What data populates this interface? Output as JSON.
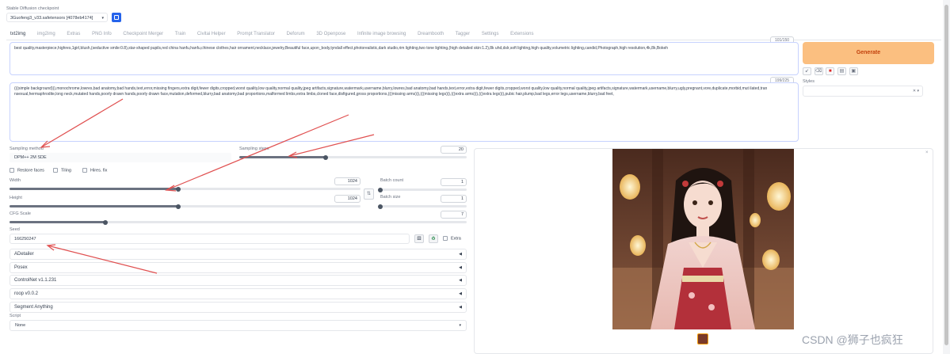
{
  "checkpoint": {
    "label": "Stable Diffusion checkpoint",
    "value": "3Guofeng3_v33.safetensors [4078eb4174]"
  },
  "tabs": [
    "txt2img",
    "img2img",
    "Extras",
    "PNG Info",
    "Checkpoint Merger",
    "Train",
    "Civitai Helper",
    "Prompt Translator",
    "Deforum",
    "3D Openpose",
    "Infinite image browsing",
    "Dreambooth",
    "Tagger",
    "Settings",
    "Extensions"
  ],
  "prompt": {
    "counter": "101/150",
    "text": "best quality,masterpiece,highres,1girl,blush,(seductive smile:0.8),star-shaped pupils,red china hanfu,hanfu,chinese clothes,hair ornament,necklace,jewelry,Beautiful face,upon_body,tyndall effect,photorealistic,dark studio,rim lighting,two tone lighting,(high detailed skin:1.2),8k uhd,dslr,soft lighting,high quality,volumetric lighting,candid,Photograph,high resolution,4k,8k,Bokeh"
  },
  "negative_prompt": {
    "counter": "199/225",
    "text": "(((simple background))),monochrome,lowres,bad anatomy,bad hands,text,error,missing fingers,extra digit,fewer digits,cropped,worst quality,low quality,normal quality,jpeg artifacts,signature,watermark,username,blurry,lowres,bad anatomy,bad hands,text,error,extra digit,fewer digits,cropped,worst quality,low quality,normal quality,jpeg artifacts,signature,watermark,username,blurry,ugly,pregnant,vore,duplicate,morbid,mut ilated,tran nsexual,hermaphrodite,long neck,mutated hands,poorly drawn hands,poorly drawn face,mutation,deformed,blurry,bad anatomy,bad proportions,malformed limbs,extra limbs,cloned face,disfigured,gross proportions,(((missing arms))),(((missing legs))),(((extra arms))),(((extra legs))),pubic hair,plump,bad legs,error legs,username,blurry,bad feet,"
  },
  "generate_label": "Generate",
  "styles_label": "Styles",
  "sampling": {
    "method_label": "Sampling method",
    "method_value": "DPM++ 2M SDE",
    "steps_label": "Sampling steps",
    "steps_value": "20",
    "steps_fraction": 0.38
  },
  "options": {
    "restore_faces": "Restore faces",
    "tiling": "Tiling",
    "hires_fix": "Hires. fix"
  },
  "width": {
    "label": "Width",
    "value": "1024",
    "fraction": 0.48
  },
  "height": {
    "label": "Height",
    "value": "1024",
    "fraction": 0.48
  },
  "batch_count": {
    "label": "Batch count",
    "value": "1",
    "fraction": 0.0
  },
  "batch_size": {
    "label": "Batch size",
    "value": "1",
    "fraction": 0.0
  },
  "swap_icon": "swap-icon",
  "cfg": {
    "label": "CFG Scale",
    "value": "7",
    "fraction": 0.21
  },
  "seed": {
    "label": "Seed",
    "value": "166250247",
    "extra_label": "Extra"
  },
  "accordions": [
    "ADetailer",
    "Posex",
    "ControlNet v1.1.231",
    "roop v0.0.2",
    "Segment Anything"
  ],
  "script": {
    "label": "Script",
    "value": "None"
  },
  "watermark": "CSDN @狮子也疯狂",
  "colors": {
    "generate_bg": "#fbbf80",
    "generate_text": "#c2410c",
    "arrow": "#e05050",
    "slider_fill": "#6b7280"
  }
}
